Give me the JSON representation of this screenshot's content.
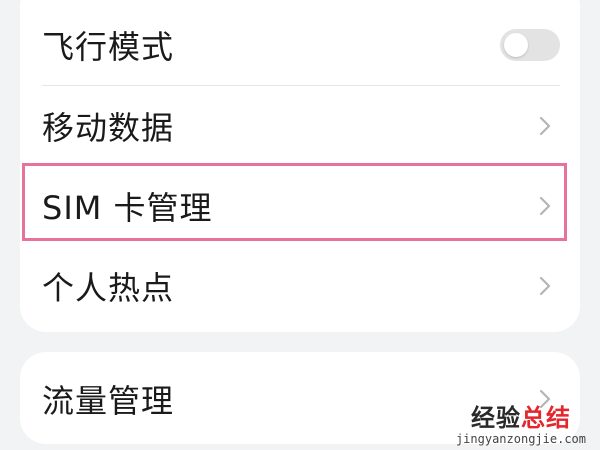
{
  "settings_group": {
    "items": [
      {
        "label": "飞行模式",
        "control": "toggle",
        "toggle_on": false
      },
      {
        "label": "移动数据",
        "control": "chevron"
      },
      {
        "label": "SIM 卡管理",
        "control": "chevron",
        "highlighted": true
      },
      {
        "label": "个人热点",
        "control": "chevron"
      }
    ]
  },
  "settings_group_2": {
    "items": [
      {
        "label": "流量管理",
        "control": "chevron"
      }
    ]
  },
  "colors": {
    "page_background": "#f1f3f5",
    "card_background": "#ffffff",
    "highlight_border": "#e8739a",
    "toggle_off": "#e3e3e3",
    "chevron": "#b5b5b5"
  },
  "watermark": {
    "part1": "经验",
    "part2": "总结",
    "url": "jingyanzongjie.com",
    "color1": "#2a2a2a",
    "color2": "#e3272d"
  }
}
